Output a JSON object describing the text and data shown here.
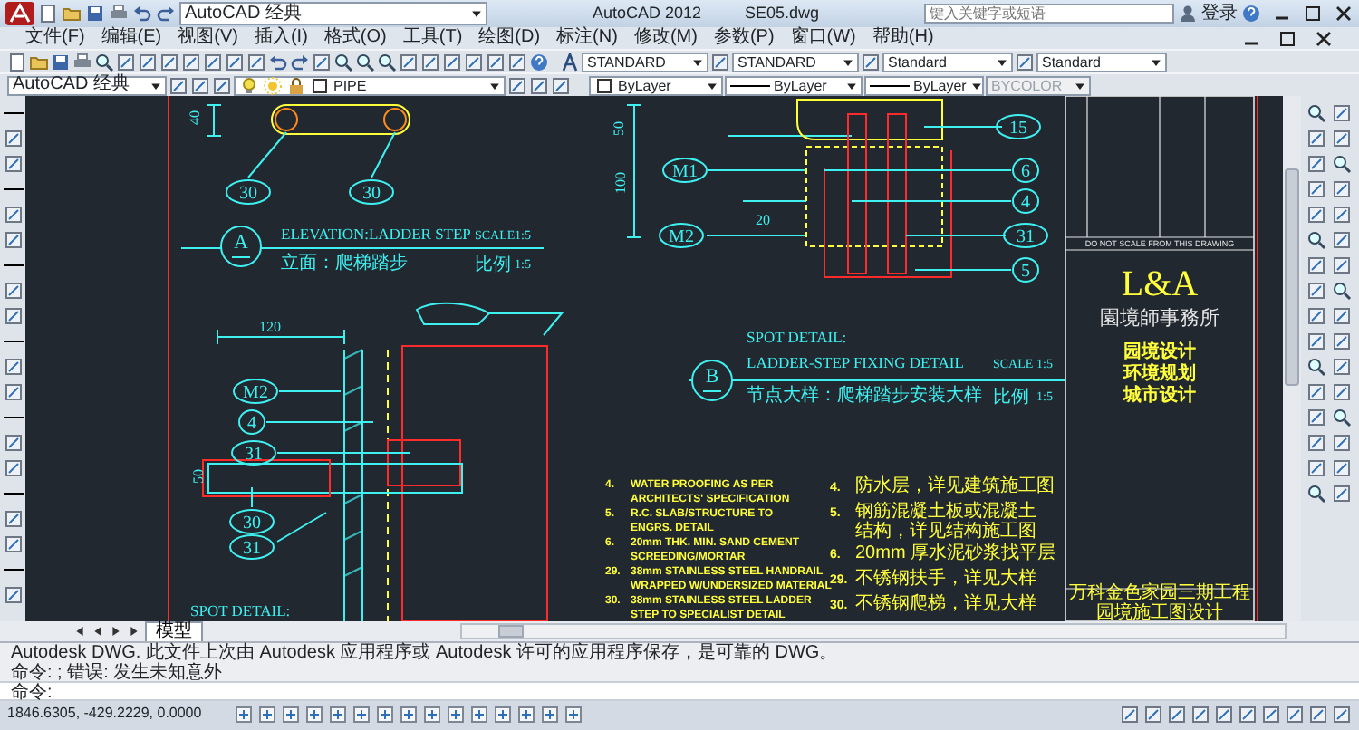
{
  "window": {
    "title": "AutoCAD 2012",
    "document": "SE05.dwg",
    "workspace": "AutoCAD 经典",
    "search": {
      "placeholder": "键入关键字或短语"
    },
    "user": "登录"
  },
  "menu": [
    "文件(F)",
    "编辑(E)",
    "视图(V)",
    "插入(I)",
    "格式(O)",
    "工具(T)",
    "绘图(D)",
    "标注(N)",
    "修改(M)",
    "参数(P)",
    "窗口(W)",
    "帮助(H)"
  ],
  "styles_toolbar": [
    "STANDARD",
    "STANDARD",
    "Standard",
    "Standard"
  ],
  "properties_toolbar": {
    "workspace": "AutoCAD 经典",
    "layer": "PIPE",
    "color_control": "ByLayer",
    "linetype": "ByLayer",
    "lineweight": "ByLayer",
    "plot_style": {
      "label": "BYCOLOR",
      "disabled": true
    }
  },
  "drawing": {
    "texts": [
      {
        "text": "ELEVATION:LADDER STEP",
        "kind": "heading"
      },
      {
        "text": "SCALE",
        "kind": "scale"
      },
      {
        "text": "1:5",
        "kind": "scale"
      },
      {
        "text": "立面：爬梯踏步",
        "kind": "heading_cn"
      },
      {
        "text": "比例",
        "kind": "label_cn"
      },
      {
        "text": "1:5",
        "kind": "scale"
      },
      {
        "text": "120",
        "kind": "dimension"
      },
      {
        "text": "50",
        "kind": "dimension_v"
      },
      {
        "text": "50",
        "kind": "dimension_v"
      },
      {
        "text": "100",
        "kind": "dimension_v"
      },
      {
        "text": "20",
        "kind": "dimension"
      },
      {
        "text": "SPOT DETAIL:",
        "kind": "heading"
      },
      {
        "text": "LADDER-STEP FIXING DETAIL",
        "kind": "heading"
      },
      {
        "text": "SCALE",
        "kind": "scale"
      },
      {
        "text": "1:5",
        "kind": "scale"
      },
      {
        "text": "节点大样：爬梯踏步安装大样",
        "kind": "heading_cn"
      },
      {
        "text": "比例",
        "kind": "label_cn"
      },
      {
        "text": "1:5",
        "kind": "scale"
      },
      {
        "text": "SPOT DETAIL:",
        "kind": "heading"
      },
      {
        "text": "40",
        "kind": "dimension_v"
      }
    ],
    "callouts": [
      "30",
      "30",
      "M1",
      "M2",
      "15",
      "6",
      "4",
      "31",
      "5",
      "M2",
      "4",
      "31",
      "30",
      "31"
    ],
    "sections": [
      "A",
      "B"
    ],
    "notes": [
      {
        "number": "4.",
        "lines": [
          "WATER PROOFING AS PER",
          "ARCHITECTS' SPECIFICATION"
        ]
      },
      {
        "number": "5.",
        "lines": [
          "R.C. SLAB/STRUCTURE TO",
          "ENGRS. DETAIL"
        ]
      },
      {
        "number": "6.",
        "lines": [
          "20mm THK. MIN. SAND CEMENT",
          "SCREEDING/MORTAR"
        ]
      },
      {
        "number": "29.",
        "lines": [
          "38mm  STAINLESS STEEL HANDRAIL",
          "WRAPPED W/UNDERSIZED MATERIAL"
        ]
      },
      {
        "number": "30.",
        "lines": [
          "38mm  STAINLESS  STEEL LADDER",
          "STEP TO SPECIALIST DETAIL"
        ]
      }
    ],
    "notes_cn": [
      {
        "number": "4.",
        "lines": [
          "防水层，详见建筑施工图"
        ]
      },
      {
        "number": "5.",
        "lines": [
          "钢筋混凝土板或混凝土",
          "结构，详见结构施工图"
        ]
      },
      {
        "number": "6.",
        "lines": [
          "20mm 厚水泥砂浆找平层"
        ]
      },
      {
        "number": "29.",
        "lines": [
          "不锈钢扶手，详见大样"
        ]
      },
      {
        "number": "30.",
        "lines": [
          "不锈钢爬梯，详见大样"
        ]
      }
    ],
    "title_block": {
      "note": "DO NOT SCALE FROM THIS DRAWING",
      "logo": "L&A",
      "firm": "園境師事務所",
      "services": [
        "园境设计",
        "环境规划",
        "城市设计"
      ],
      "project": [
        "万科金色家园三期工程",
        "园境施工图设计"
      ]
    }
  },
  "layout_tabs": [
    {
      "label": "模型",
      "selected": true
    }
  ],
  "command_history": [
    "Autodesk DWG.  此文件上次由 Autodesk 应用程序或 Autodesk 许可的应用程序保存，是可靠的 DWG。",
    "命令: ; 错误: 发生未知意外"
  ],
  "command_prompt": "命令:",
  "coordinates": "1846.6305, -429.2229, 0.0000"
}
